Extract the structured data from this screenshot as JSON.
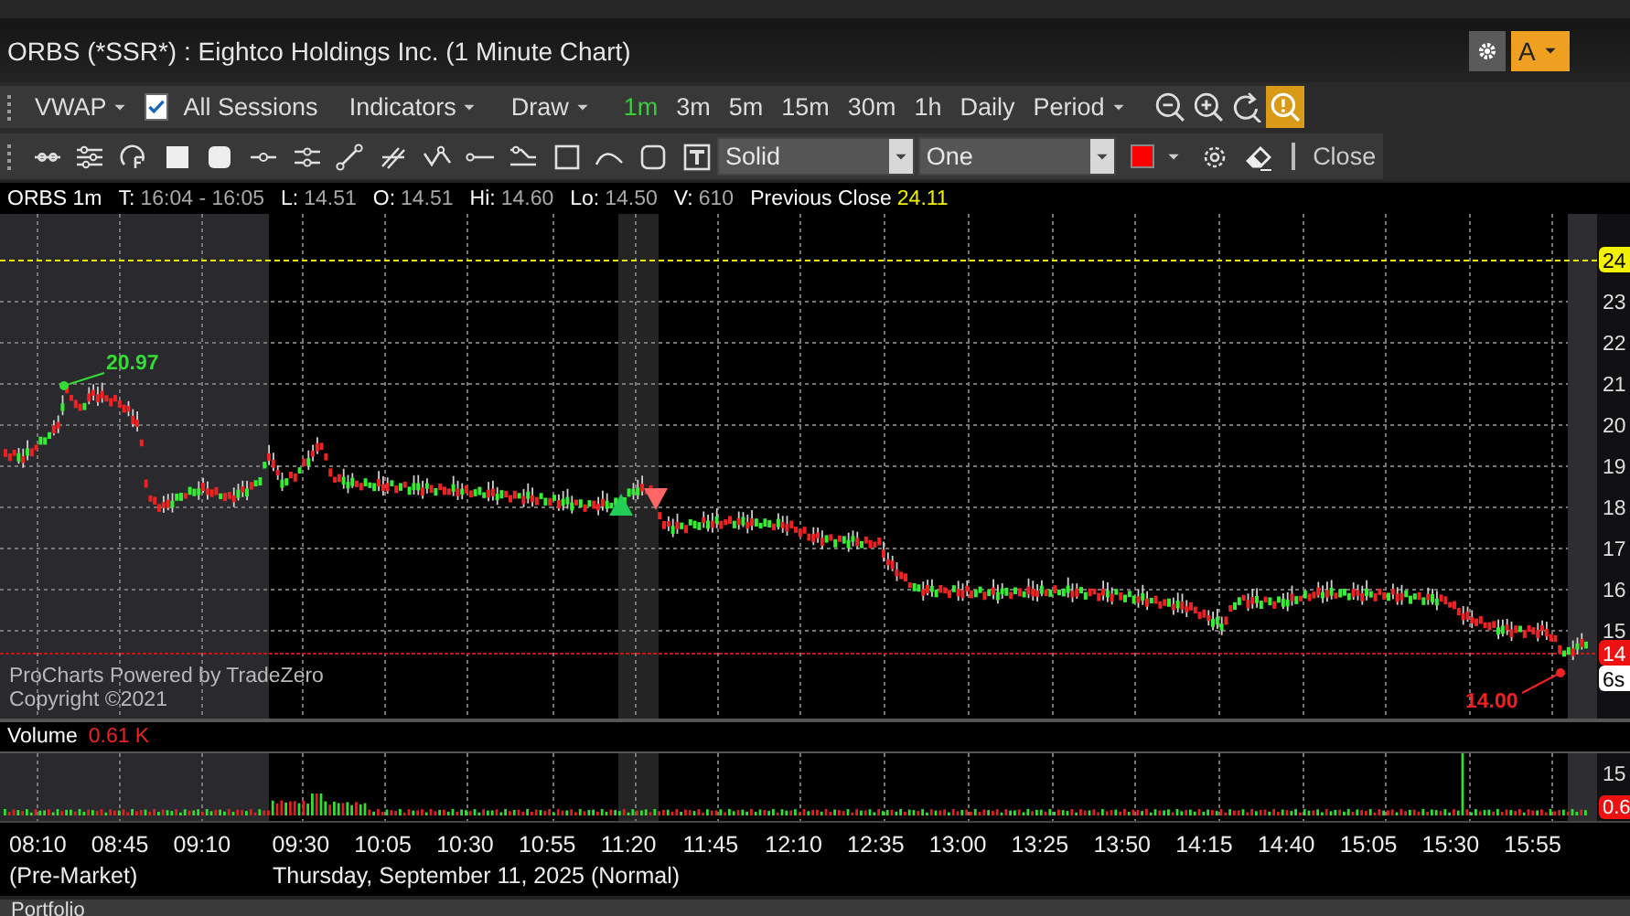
{
  "window": {
    "title": "ORBS (*SSR*) : Eightco Holdings Inc. (1 Minute Chart)"
  },
  "header_buttons": [
    {
      "kind": "settings"
    },
    {
      "kind": "account",
      "label": "A"
    }
  ],
  "toolbar": [
    {
      "kind": "dropdown",
      "label": "VWAP"
    },
    {
      "kind": "checkbox",
      "label": "All Sessions",
      "checked": true
    },
    {
      "kind": "separator"
    },
    {
      "kind": "dropdown",
      "label": "Indicators"
    },
    {
      "kind": "separator"
    },
    {
      "kind": "dropdown",
      "label": "Draw"
    },
    {
      "kind": "separator"
    },
    {
      "kind": "interval",
      "label": "1m",
      "selected": true
    },
    {
      "kind": "interval",
      "label": "3m",
      "selected": false
    },
    {
      "kind": "interval",
      "label": "5m",
      "selected": false
    },
    {
      "kind": "interval",
      "label": "15m",
      "selected": false
    },
    {
      "kind": "interval",
      "label": "30m",
      "selected": false
    },
    {
      "kind": "interval",
      "label": "1h",
      "selected": false
    },
    {
      "kind": "interval",
      "label": "Daily",
      "selected": false
    },
    {
      "kind": "dropdown",
      "label": "Period"
    },
    {
      "kind": "separator"
    },
    {
      "kind": "zoom-out",
      "on": false
    },
    {
      "kind": "zoom-in",
      "on": false
    },
    {
      "kind": "reset",
      "on": false
    },
    {
      "kind": "zoom-mode",
      "on": true
    }
  ],
  "drawing_tools": [
    {
      "kind": "dotted-line"
    },
    {
      "kind": "sliders"
    },
    {
      "kind": "fib"
    },
    {
      "kind": "filled-square"
    },
    {
      "kind": "rounded-square"
    },
    {
      "kind": "dot-line"
    },
    {
      "kind": "channel"
    },
    {
      "kind": "segment"
    },
    {
      "kind": "crossed-lines"
    },
    {
      "kind": "polyline"
    },
    {
      "kind": "h-line"
    },
    {
      "kind": "steps"
    },
    {
      "kind": "rectangle"
    },
    {
      "kind": "curve"
    },
    {
      "kind": "round-rect"
    },
    {
      "kind": "text-box"
    }
  ],
  "line_style": {
    "value": "Solid"
  },
  "line_width": {
    "value": "One"
  },
  "line_color": {
    "color": "#ff0000"
  },
  "close_label": "Close",
  "info_bar": [
    {
      "label": "ORBS 1m"
    },
    {
      "label": "T:",
      "value": "16:04 - 16:05",
      "highlight": false
    },
    {
      "label": "L:",
      "value": "14.51",
      "highlight": false
    },
    {
      "label": "O:",
      "value": "14.51",
      "highlight": false
    },
    {
      "label": "Hi:",
      "value": "14.60",
      "highlight": false
    },
    {
      "label": "Lo:",
      "value": "14.50",
      "highlight": false
    },
    {
      "label": "V:",
      "value": "610",
      "highlight": false
    },
    {
      "label": "Previous Close",
      "value": "24.11",
      "highlight": true
    }
  ],
  "price_chart": {
    "y_axis": [
      {
        "text": "24",
        "kind": "prev-close"
      },
      {
        "text": "23",
        "kind": "tick"
      },
      {
        "text": "22",
        "kind": "tick"
      },
      {
        "text": "21",
        "kind": "tick"
      },
      {
        "text": "20",
        "kind": "tick"
      },
      {
        "text": "19",
        "kind": "tick"
      },
      {
        "text": "18",
        "kind": "tick"
      },
      {
        "text": "17",
        "kind": "tick"
      },
      {
        "text": "16",
        "kind": "tick"
      },
      {
        "text": "15",
        "kind": "tick"
      },
      {
        "text": "14",
        "kind": "last"
      },
      {
        "text": "6s",
        "kind": "timer"
      }
    ],
    "annotations": [
      {
        "kind": "high",
        "text": "20.97"
      },
      {
        "kind": "low",
        "text": "14.00"
      }
    ],
    "signals": [
      {
        "kind": "buy"
      },
      {
        "kind": "sell"
      }
    ],
    "watermark": [
      "ProCharts Powered by TradeZero",
      "Copyright ©2021"
    ]
  },
  "volume": {
    "title": "Volume",
    "value": "0.61 K",
    "y_axis": [
      {
        "text": "15",
        "kind": "tick"
      },
      {
        "text": "0.6",
        "kind": "last"
      }
    ]
  },
  "time_axis": {
    "labels": [
      "08:10",
      "08:45",
      "09:10",
      "09:30",
      "10:05",
      "10:30",
      "10:55",
      "11:20",
      "11:45",
      "12:10",
      "12:35",
      "13:00",
      "13:25",
      "13:50",
      "14:15",
      "14:40",
      "15:05",
      "15:30",
      "15:55"
    ],
    "sessions": [
      "(Pre-Market)",
      "Thursday, September 11, 2025 (Normal)"
    ]
  },
  "bottom_panel": {
    "title": "Portfolio"
  }
}
